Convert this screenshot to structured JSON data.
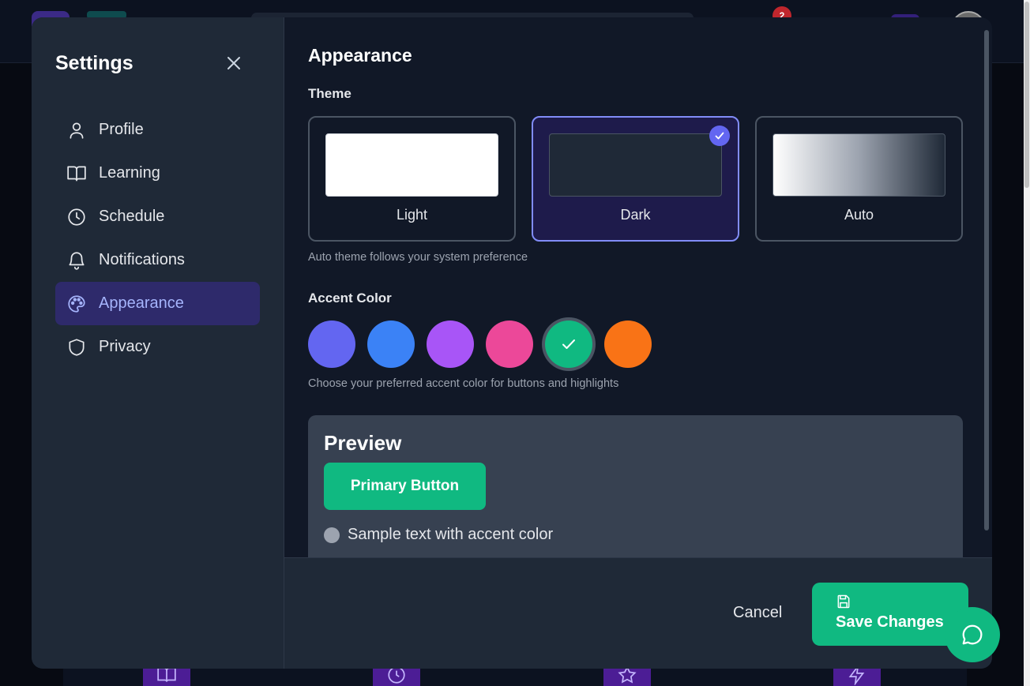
{
  "background": {
    "notification_count": "2"
  },
  "sidebar": {
    "title": "Settings",
    "items": [
      {
        "label": "Profile",
        "icon": "user-icon",
        "active": false
      },
      {
        "label": "Learning",
        "icon": "book-icon",
        "active": false
      },
      {
        "label": "Schedule",
        "icon": "clock-icon",
        "active": false
      },
      {
        "label": "Notifications",
        "icon": "bell-icon",
        "active": false
      },
      {
        "label": "Appearance",
        "icon": "palette-icon",
        "active": true
      },
      {
        "label": "Privacy",
        "icon": "shield-icon",
        "active": false
      }
    ]
  },
  "appearance": {
    "title": "Appearance",
    "theme_label": "Theme",
    "themes": [
      {
        "name": "Light",
        "selected": false
      },
      {
        "name": "Dark",
        "selected": true
      },
      {
        "name": "Auto",
        "selected": false
      }
    ],
    "theme_hint": "Auto theme follows your system preference",
    "accent_label": "Accent Color",
    "accent_colors": [
      {
        "hex": "#6366f1",
        "selected": false
      },
      {
        "hex": "#3b82f6",
        "selected": false
      },
      {
        "hex": "#a855f7",
        "selected": false
      },
      {
        "hex": "#ec4899",
        "selected": false
      },
      {
        "hex": "#10b981",
        "selected": true
      },
      {
        "hex": "#f97316",
        "selected": false
      }
    ],
    "accent_hint": "Choose your preferred accent color for buttons and highlights",
    "preview": {
      "title": "Preview",
      "button_label": "Primary Button",
      "sample_text": "Sample text with accent color"
    }
  },
  "footer": {
    "cancel_label": "Cancel",
    "save_label": "Save Changes"
  }
}
